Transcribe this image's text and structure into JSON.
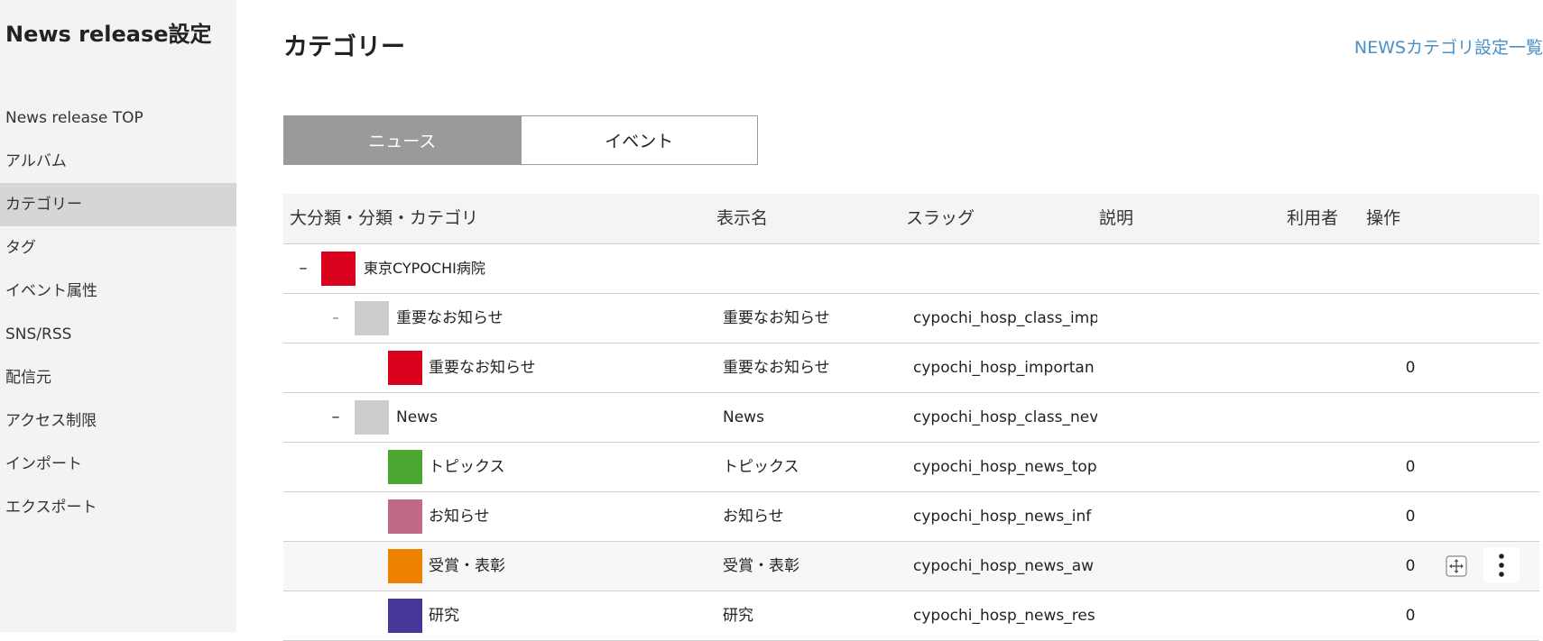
{
  "sidebar": {
    "title": "News release設定",
    "items": [
      {
        "label": "News release TOP"
      },
      {
        "label": "アルバム"
      },
      {
        "label": "カテゴリー"
      },
      {
        "label": "タグ"
      },
      {
        "label": "イベント属性"
      },
      {
        "label": "SNS/RSS"
      },
      {
        "label": "配信元"
      },
      {
        "label": "アクセス制限"
      },
      {
        "label": "インポート"
      },
      {
        "label": "エクスポート"
      }
    ],
    "active_item": "カテゴリー"
  },
  "main": {
    "title": "カテゴリー",
    "top_link": "NEWSカテゴリ設定一覧",
    "tabs": [
      {
        "label": "ニュース",
        "active": true
      },
      {
        "label": "イベント",
        "active": false
      }
    ]
  },
  "table": {
    "headers": {
      "category": "大分類・分類・カテゴリ",
      "display_name": "表示名",
      "slug": "スラッグ",
      "description": "説明",
      "users": "利用者",
      "actions": "操作"
    },
    "rows": [
      {
        "level": 0,
        "toggle": "–",
        "color": "#d9001b",
        "name": "東京CYPOCHI病院",
        "display": "",
        "slug": "",
        "users": ""
      },
      {
        "level": 1,
        "toggle": "–",
        "color": "#cccccc",
        "name": "重要なお知らせ",
        "display": "重要なお知らせ",
        "slug": "cypochi_hosp_class_imp",
        "users": ""
      },
      {
        "level": 2,
        "toggle": "",
        "color": "#d9001b",
        "name": "重要なお知らせ",
        "display": "重要なお知らせ",
        "slug": "cypochi_hosp_importan",
        "users": "0"
      },
      {
        "level": 1,
        "toggle": "–",
        "color": "#cccccc",
        "name": "News",
        "display": "News",
        "slug": "cypochi_hosp_class_nev",
        "users": ""
      },
      {
        "level": 2,
        "toggle": "",
        "color": "#4aa832",
        "name": "トピックス",
        "display": "トピックス",
        "slug": "cypochi_hosp_news_top",
        "users": "0"
      },
      {
        "level": 2,
        "toggle": "",
        "color": "#c06a88",
        "name": "お知らせ",
        "display": "お知らせ",
        "slug": "cypochi_hosp_news_inf",
        "users": "0"
      },
      {
        "level": 2,
        "toggle": "",
        "color": "#ee8200",
        "name": "受賞・表彰",
        "display": "受賞・表彰",
        "slug": "cypochi_hosp_news_aw",
        "users": "0",
        "hover": true
      },
      {
        "level": 2,
        "toggle": "",
        "color": "#45389a",
        "name": "研究",
        "display": "研究",
        "slug": "cypochi_hosp_news_res",
        "users": "0"
      }
    ],
    "row_actions_icons": [
      "move-icon",
      "more-vertical-icon"
    ]
  }
}
